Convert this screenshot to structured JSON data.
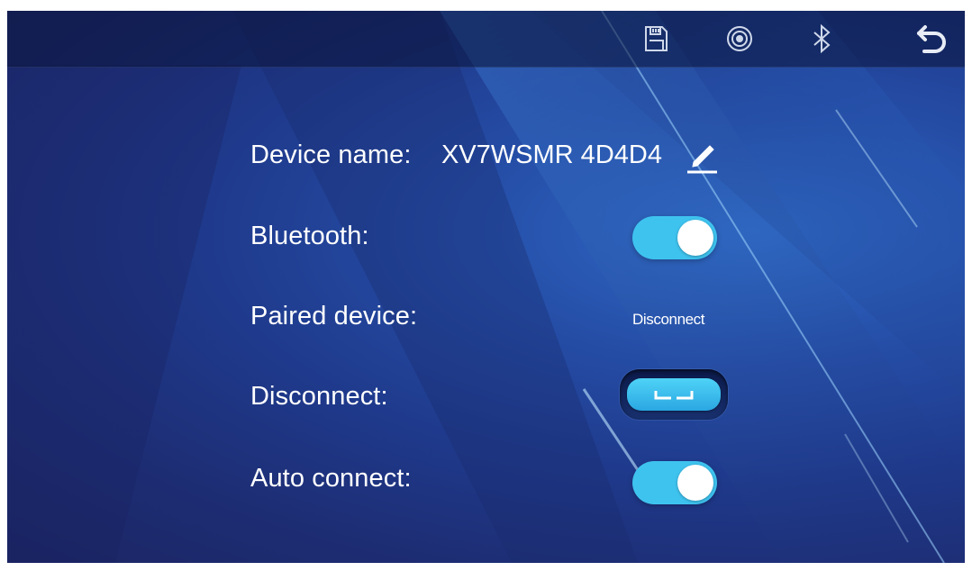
{
  "settings": {
    "device_name_label": "Device name:",
    "device_name_value": "XV7WSMR 4D4D4",
    "bluetooth_label": "Bluetooth:",
    "bluetooth_enabled": true,
    "paired_device_label": "Paired device:",
    "paired_device_value": "Disconnect",
    "disconnect_label": "Disconnect:",
    "auto_connect_label": "Auto connect:",
    "auto_connect_enabled": true
  },
  "toolbar": {
    "icons": [
      "save-icon",
      "wireless-signal-icon",
      "bluetooth-icon",
      "back-icon"
    ]
  },
  "colors": {
    "background": "#1f3a8c",
    "toggle_on": "#3ec3ef",
    "text": "#ffffff"
  }
}
